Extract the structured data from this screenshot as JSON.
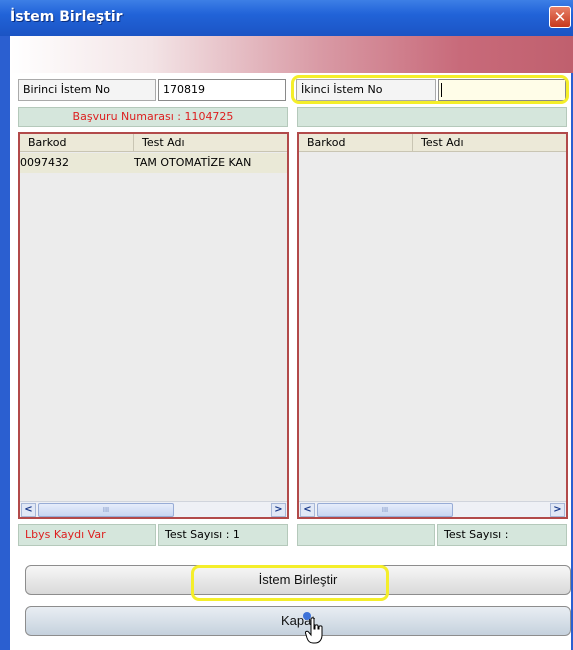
{
  "window": {
    "title": "İstem Birleştir",
    "close_glyph": "✕"
  },
  "first": {
    "label": "Birinci İstem No",
    "value": "170819",
    "basvuru": "Başvuru Numarası : 1104725",
    "columns": [
      "Barkod",
      "Test Adı"
    ],
    "rows": [
      {
        "barkod": "0097432",
        "test_adi": "TAM OTOMATİZE KAN"
      }
    ],
    "lbys": "Lbys Kaydı Var",
    "test_sayisi": "Test Sayısı : 1"
  },
  "second": {
    "label": "İkinci İstem No",
    "value": "",
    "columns": [
      "Barkod",
      "Test Adı"
    ],
    "test_sayisi": "Test Sayısı :"
  },
  "scroll": {
    "left": "<",
    "right": ">",
    "grip": "III"
  },
  "buttons": {
    "merge": "İstem Birleştir",
    "close": "Kapat"
  },
  "colors": {
    "highlight": "#f4ee2a",
    "grid_border": "#b24a4a",
    "red_text": "#dd1f1f",
    "title_bar": "#2163d8"
  }
}
